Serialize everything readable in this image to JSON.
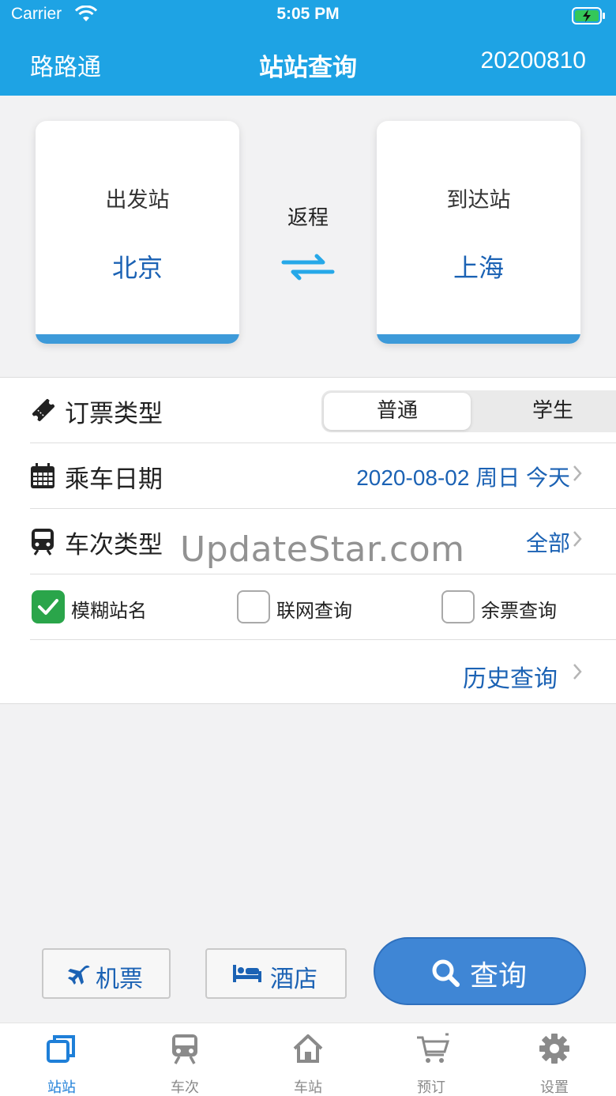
{
  "status": {
    "carrier": "Carrier",
    "time": "5:05 PM"
  },
  "nav": {
    "left": "路路通",
    "title": "站站查询",
    "right": "20200810"
  },
  "stations": {
    "from_label": "出发站",
    "from_value": "北京",
    "to_label": "到达站",
    "to_value": "上海",
    "return_label": "返程"
  },
  "ticket_type": {
    "label": "订票类型",
    "options": [
      "普通",
      "学生"
    ],
    "selected": "普通"
  },
  "date": {
    "label": "乘车日期",
    "value": "2020-08-02 周日 今天"
  },
  "train_type": {
    "label": "车次类型",
    "value": "全部"
  },
  "checkboxes": [
    {
      "label": "模糊站名",
      "checked": true
    },
    {
      "label": "联网查询",
      "checked": false
    },
    {
      "label": "余票查询",
      "checked": false
    }
  ],
  "history": {
    "label": "历史查询"
  },
  "watermark": "UpdateStar.com",
  "buttons": {
    "flight": "机票",
    "hotel": "酒店",
    "query": "查询"
  },
  "tabs": [
    {
      "label": "站站",
      "icon": "station-to-station-icon",
      "active": true
    },
    {
      "label": "车次",
      "icon": "train-icon",
      "active": false
    },
    {
      "label": "车站",
      "icon": "home-icon",
      "active": false
    },
    {
      "label": "预订",
      "icon": "cart-icon",
      "active": false
    },
    {
      "label": "设置",
      "icon": "gear-icon",
      "active": false
    }
  ],
  "colors": {
    "header": "#1ea3e4",
    "accent": "#1b62b4",
    "check": "#2aa54a",
    "query_button": "#3f86d5"
  }
}
